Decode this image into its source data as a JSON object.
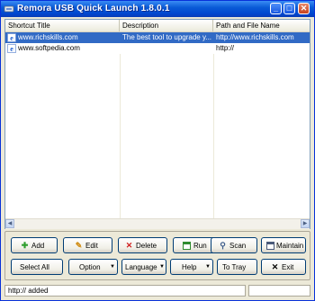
{
  "window": {
    "title": "Remora USB Quick Launch 1.8.0.1",
    "controls": {
      "minimize": "_",
      "maximize": "□",
      "close": "✕"
    }
  },
  "list": {
    "columns": [
      "Shortcut Title",
      "Description",
      "Path and File Name"
    ],
    "rows": [
      {
        "title": "www.richskills.com",
        "description": "The best tool to upgrade y...",
        "path": "http://www.richskills.com",
        "selected": true,
        "icon": "ie-globe-icon"
      },
      {
        "title": "www.softpedia.com",
        "description": "",
        "path": "http://",
        "selected": false,
        "icon": "ie-globe-icon"
      }
    ]
  },
  "buttons": {
    "add": "Add",
    "edit": "Edit",
    "delete": "Delete",
    "run": "Run",
    "scan": "Scan",
    "maintain": "Maintain",
    "select_all": "Select All",
    "option": "Option",
    "language": "Language",
    "help": "Help",
    "to_tray": "To Tray",
    "exit": "Exit"
  },
  "status": {
    "text": "http:// added",
    "pane2": ""
  },
  "colors": {
    "titlebar": "#0a5bd7",
    "selection": "#316ac5",
    "add_icon": "#2e9e2e",
    "delete_icon": "#d02020",
    "run_icon": "#2e8b2e"
  }
}
